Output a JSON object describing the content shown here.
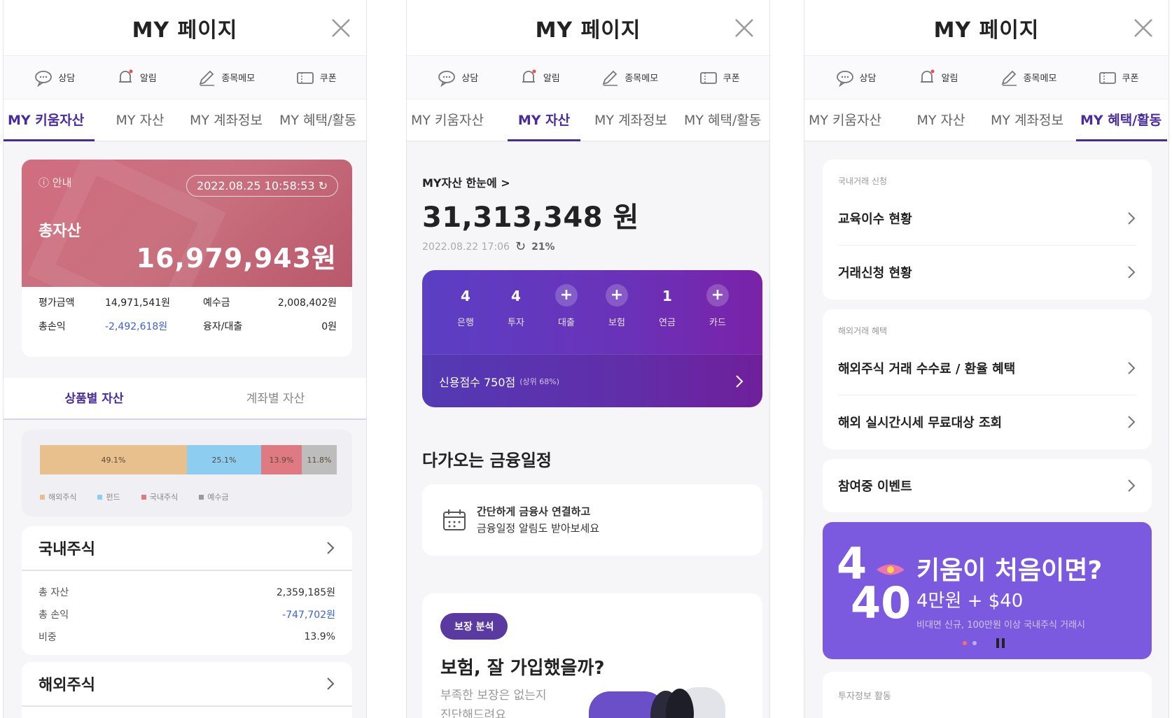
{
  "common": {
    "title": "MY 페이지",
    "quick": [
      "상담",
      "알림",
      "종목메모",
      "쿠폰"
    ],
    "tabs": [
      "MY 키움자산",
      "MY 자산",
      "MY 계좌정보",
      "MY 혜택/활동"
    ]
  },
  "panel1": {
    "notice": "ⓘ 안내",
    "datetime": "2022.08.25 10:58:53",
    "total_label": "총자산",
    "total_amount": "16,979,943원",
    "summary": [
      {
        "label": "평가금액",
        "value": "14,971,541원",
        "label2": "예수금",
        "value2": "2,008,402원"
      },
      {
        "label": "총손익",
        "value": "-2,492,618원",
        "label2": "융자/대출",
        "value2": "0원"
      }
    ],
    "subtabs": [
      "상품별 자산",
      "계좌별 자산"
    ],
    "bar_labels": [
      "49.1%",
      "25.1%",
      "13.9%",
      "11.8%"
    ],
    "legend": [
      "해외주식",
      "펀드",
      "국내주식",
      "예수금"
    ],
    "colors": {
      "overseas": "#e8c08e",
      "fund": "#8ccdf0",
      "domestic": "#e07a82",
      "deposit": "#bdbdbd"
    },
    "domestic": {
      "title": "국내주식",
      "rows": [
        {
          "label": "총 자산",
          "value": "2,359,185원"
        },
        {
          "label": "총 손익",
          "value": "-747,702원"
        },
        {
          "label": "비중",
          "value": "13.9%"
        }
      ]
    },
    "overseas_title": "해외주식"
  },
  "panel2": {
    "summary_link": "MY자산 한눈에 >",
    "total": "31,313,348 원",
    "timestamp": "2022.08.22 17:06",
    "percent": "21%",
    "categories": [
      {
        "value": "4",
        "name": "은행"
      },
      {
        "value": "4",
        "name": "투자"
      },
      {
        "value": "+",
        "name": "대출"
      },
      {
        "value": "+",
        "name": "보험"
      },
      {
        "value": "1",
        "name": "연금"
      },
      {
        "value": "+",
        "name": "카드"
      }
    ],
    "credit": "신용점수 750점",
    "credit_rank": "(상위 68%)",
    "schedule_title": "다가오는 금융일정",
    "schedule_line1": "간단하게 금융사 연결하고",
    "schedule_line2": "금융일정 알림도 받아보세요",
    "insurance_pill": "보장 분석",
    "insurance_title": "보험, 잘 가입했을까?",
    "insurance_sub1": "부족한 보장은 없는지",
    "insurance_sub2": "진단해드려요"
  },
  "panel3": {
    "group1_caption": "국내거래 신청",
    "group1_items": [
      "교육이수 현황",
      "거래신청 현황"
    ],
    "group2_caption": "해외거래 혜택",
    "group2_items": [
      "해외주식 거래 수수료 / 환율 혜택",
      "해외 실시간시세 무료대상 조회"
    ],
    "event": "참여중 이벤트",
    "banner_num1": "4",
    "banner_num2": "40",
    "banner_title": "키움이 처음이면?",
    "banner_price": "4만원 + $40",
    "banner_fine": "비대면 신규, 100만원 이상 국내주식 거래시",
    "bottom_caption": "투자정보 활동"
  }
}
